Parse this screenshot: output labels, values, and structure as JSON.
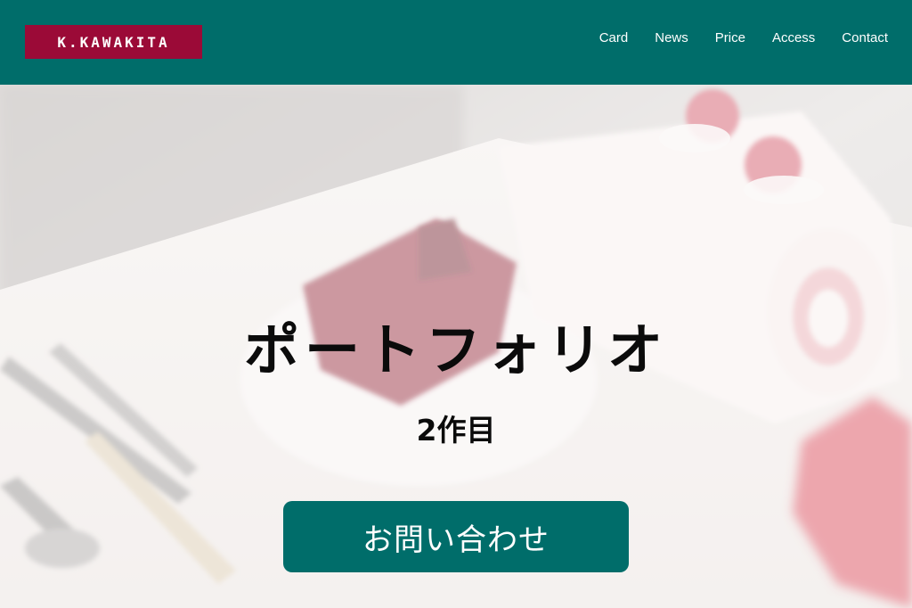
{
  "header": {
    "logo_text": "K.KAWAKITA",
    "nav": [
      "Card",
      "News",
      "Price",
      "Access",
      "Contact"
    ]
  },
  "hero": {
    "title": "ポートフォリオ",
    "subtitle": "2作目",
    "cta_label": "お問い合わせ"
  },
  "colors": {
    "header_bg": "#006d6a",
    "logo_bg": "#9b0a37",
    "button_bg": "#006d6a"
  }
}
